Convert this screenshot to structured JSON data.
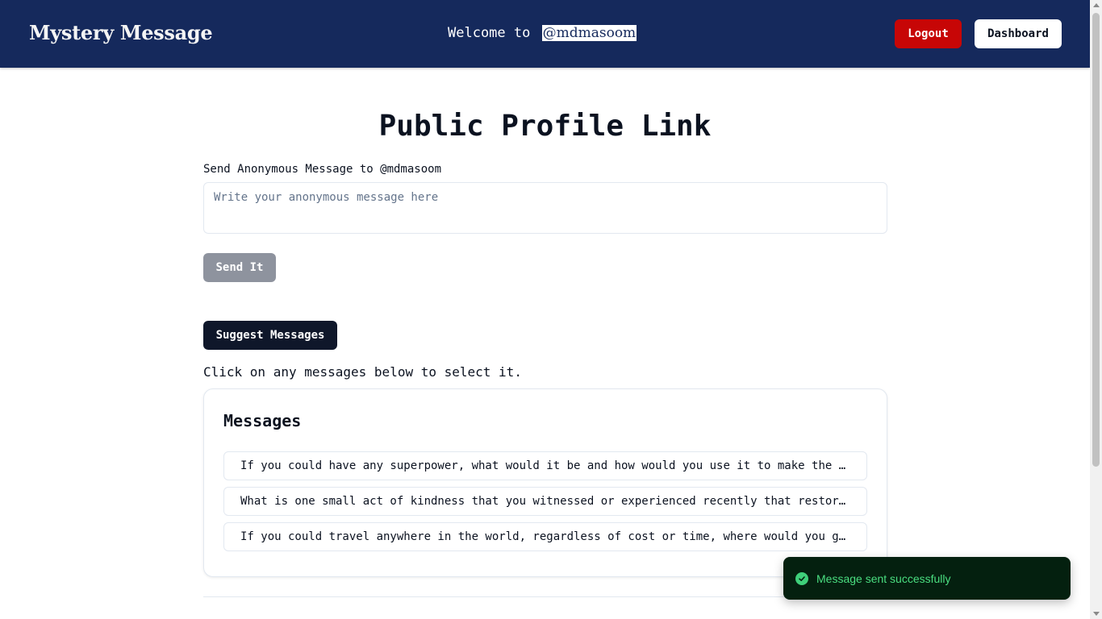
{
  "navbar": {
    "brand": "Mystery Message",
    "welcome_prefix": "Welcome to",
    "username": "@mdmasoom",
    "logout_label": "Logout",
    "dashboard_label": "Dashboard"
  },
  "main": {
    "title": "Public Profile Link",
    "field_label": "Send Anonymous Message to @mdmasoom",
    "input_placeholder": "Write your anonymous message here",
    "input_value": "",
    "send_label": "Send It",
    "suggest_label": "Suggest Messages",
    "hint": "Click on any messages below to select it."
  },
  "suggestions": {
    "title": "Messages",
    "items": [
      "If you could have any superpower, what would it be and how would you use it to make the world a better place?",
      "What is one small act of kindness that you witnessed or experienced recently that restored your faith in humanity?",
      "If you could travel anywhere in the world, regardless of cost or time, where would you go and why?"
    ]
  },
  "toast": {
    "message": "Message sent successfully",
    "status": "success",
    "icon": "check-circle-icon"
  },
  "colors": {
    "navbar": "#15295c",
    "logout": "#c70606",
    "send_disabled": "#8e939e",
    "suggest": "#0f172a",
    "toast_bg": "#04200f",
    "toast_text": "#4ade80"
  }
}
